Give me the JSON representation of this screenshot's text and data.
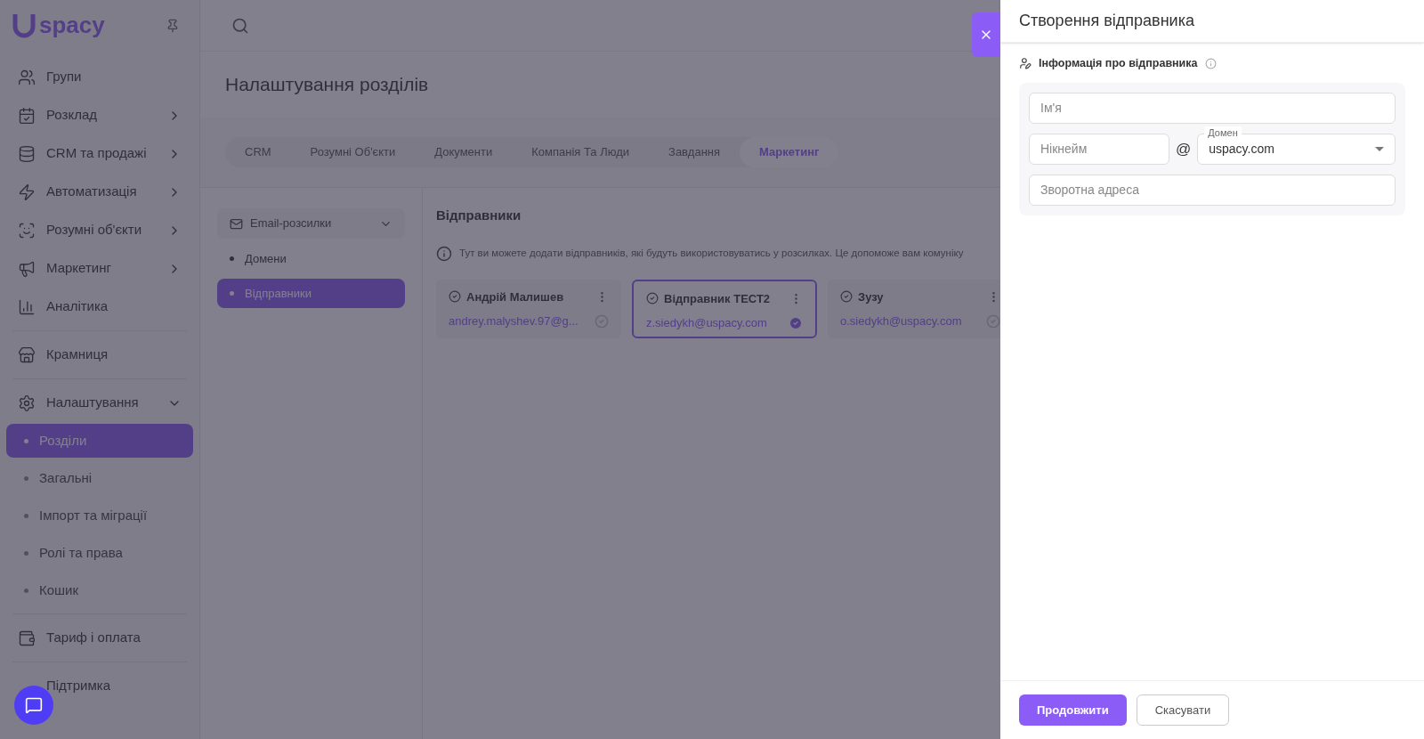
{
  "logo": {
    "text": "spacy"
  },
  "sidebar": {
    "items": [
      {
        "kind": "link",
        "label": "Групи"
      },
      {
        "kind": "menu",
        "label": "Розклад"
      },
      {
        "kind": "menu",
        "label": "CRM та продажі"
      },
      {
        "kind": "menu",
        "label": "Автоматизація"
      },
      {
        "kind": "menu",
        "label": "Розумні об'єкти"
      },
      {
        "kind": "menu",
        "label": "Маркетинг"
      },
      {
        "kind": "link",
        "label": "Аналітика"
      },
      {
        "kind": "divider"
      },
      {
        "kind": "link",
        "label": "Крамниця"
      },
      {
        "kind": "divider"
      },
      {
        "kind": "group",
        "label": "Налаштування",
        "expanded": true,
        "children": [
          {
            "label": "Розділи",
            "selected": true
          },
          {
            "label": "Загальні",
            "selected": false
          },
          {
            "label": "Імпорт та міграції",
            "selected": false
          },
          {
            "label": "Ролі та права",
            "selected": false
          },
          {
            "label": "Кошик",
            "selected": false
          }
        ]
      },
      {
        "kind": "divider"
      },
      {
        "kind": "link",
        "label": "Тариф і оплата"
      },
      {
        "kind": "divider"
      },
      {
        "kind": "link",
        "label": "Підтримка"
      }
    ]
  },
  "page": {
    "title": "Налаштування розділів",
    "tabs": [
      {
        "label": "CRM",
        "selected": false
      },
      {
        "label": "Розумні Об'єкти",
        "selected": false
      },
      {
        "label": "Документи",
        "selected": false
      },
      {
        "label": "Компанія Та Люди",
        "selected": false
      },
      {
        "label": "Завдання",
        "selected": false
      },
      {
        "label": "Маркетинг",
        "selected": true
      }
    ],
    "submenu": {
      "label": "Email-розсилки",
      "expanded": true,
      "items": [
        {
          "label": "Домени",
          "selected": false
        },
        {
          "label": "Відправники",
          "selected": true
        }
      ]
    },
    "section_title": "Відправники",
    "info": "Тут ви можете додати відправників, які будуть використовуватись у розсилках. Це допоможе вам комуніку",
    "senders": [
      {
        "name": "Андрій Малишев",
        "email": "andrey.malyshev.97@g...",
        "selected": false
      },
      {
        "name": "Відправник ТЕСТ2",
        "email": "z.siedykh@uspacy.com",
        "selected": true
      },
      {
        "name": "Зузу",
        "email": "o.siedykh@uspacy.com",
        "selected": false
      }
    ]
  },
  "drawer": {
    "title": "Створення відправника",
    "section": "Інформація про відправника",
    "fields": {
      "name": {
        "placeholder": "Ім'я"
      },
      "nickname": {
        "placeholder": "Нікнейм"
      },
      "at": "@",
      "domain": {
        "label": "Домен",
        "value": "uspacy.com"
      },
      "reply_to": {
        "placeholder": "Зворотна адреса"
      }
    },
    "buttons": [
      {
        "label": "Продовжити",
        "kind": "primary"
      },
      {
        "label": "Скасувати",
        "kind": "secondary"
      }
    ]
  }
}
